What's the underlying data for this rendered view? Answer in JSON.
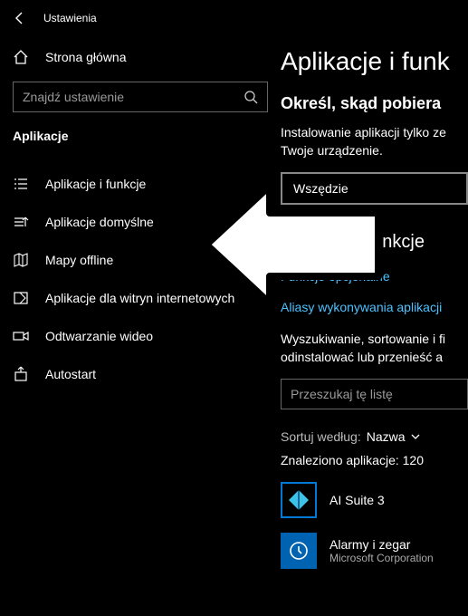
{
  "titlebar": {
    "title": "Ustawienia"
  },
  "home": {
    "label": "Strona główna"
  },
  "search": {
    "placeholder": "Znajdź ustawienie"
  },
  "section": "Aplikacje",
  "nav": {
    "items": [
      {
        "label": "Aplikacje i funkcje"
      },
      {
        "label": "Aplikacje domyślne"
      },
      {
        "label": "Mapy offline"
      },
      {
        "label": "Aplikacje dla witryn internetowych"
      },
      {
        "label": "Odtwarzanie wideo"
      },
      {
        "label": "Autostart"
      }
    ]
  },
  "main": {
    "heading": "Aplikacje i funk",
    "sub": "Określ, skąd pobiera",
    "body1": "Instalowanie aplikacji tylko ze",
    "body2": "Twoje urządzenie.",
    "dropdown": "Wszędzie",
    "heading2_suffix": "i funkcje",
    "link1": "Funkcje opcjonalne",
    "link2": "Aliasy wykonywania aplikacji",
    "body3": "Wyszukiwanie, sortowanie i fi",
    "body4": "odinstalować lub przenieść a",
    "filter": "Przeszukaj tę listę",
    "sort_label": "Sortuj według:",
    "sort_value": "Nazwa",
    "found": "Znaleziono aplikacje: 120",
    "apps": [
      {
        "name": "AI Suite 3",
        "vendor": ""
      },
      {
        "name": "Alarmy i zegar",
        "vendor": "Microsoft Corporation"
      }
    ]
  }
}
